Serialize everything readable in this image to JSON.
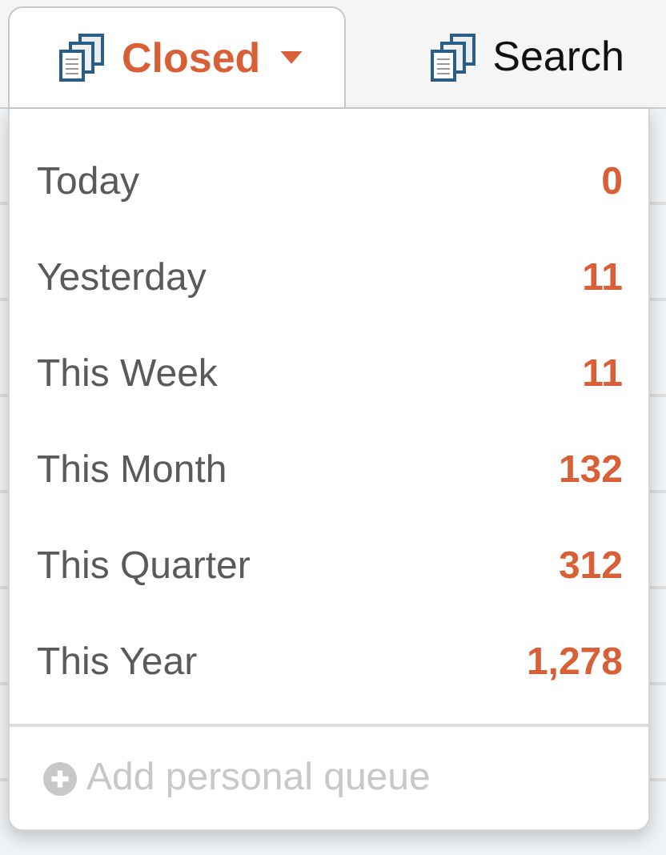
{
  "tabs": [
    {
      "label": "Closed",
      "selected": true,
      "dropdown": true
    },
    {
      "label": "Search",
      "selected": false,
      "dropdown": false
    }
  ],
  "menu": {
    "items": [
      {
        "label": "Today",
        "count": "0"
      },
      {
        "label": "Yesterday",
        "count": "11"
      },
      {
        "label": "This Week",
        "count": "11"
      },
      {
        "label": "This Month",
        "count": "132"
      },
      {
        "label": "This Quarter",
        "count": "312"
      },
      {
        "label": "This Year",
        "count": "1,278"
      }
    ],
    "footer": {
      "label": "Add personal queue",
      "disabled": true
    }
  }
}
